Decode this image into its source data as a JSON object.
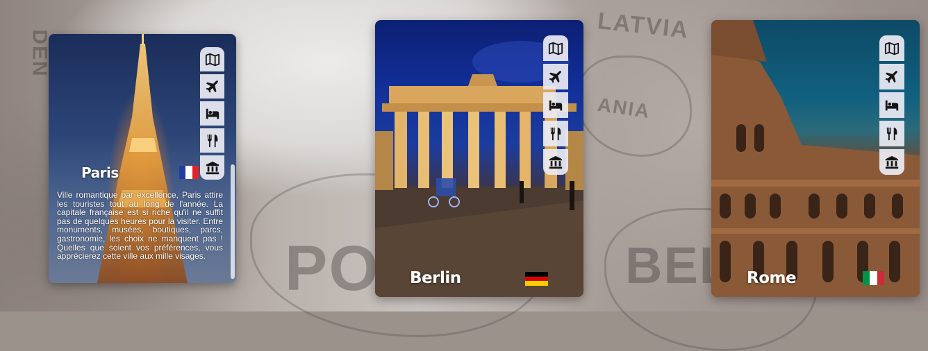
{
  "background_map": {
    "labels": [
      "LATVIA",
      "DEN",
      "ANIA",
      "POLAND",
      "BEL"
    ]
  },
  "action_icons": [
    "map-icon",
    "plane-icon",
    "bed-icon",
    "restaurant-icon",
    "museum-icon"
  ],
  "cards": {
    "paris": {
      "name": "Paris",
      "flag": "France",
      "flag_colors": [
        "#1f3fa0",
        "#ffffff",
        "#e0232a"
      ],
      "description": "Ville romantique par excellence, Paris attire les touristes tout au long de l'année. La capitale française est si riche qu'il ne suffit pas de quelques heures pour la visiter. Entre monuments, musées, boutiques, parcs, gastronomie, les choix ne manquent pas ! Quelles que soient vos préférences, vous apprécierez cette ville aux mille visages."
    },
    "berlin": {
      "name": "Berlin",
      "flag": "Germany",
      "flag_colors": [
        "#000000",
        "#dd0000",
        "#ffce00"
      ]
    },
    "rome": {
      "name": "Rome",
      "flag": "Italy",
      "flag_colors": [
        "#009246",
        "#ffffff",
        "#ce2b37"
      ]
    }
  }
}
